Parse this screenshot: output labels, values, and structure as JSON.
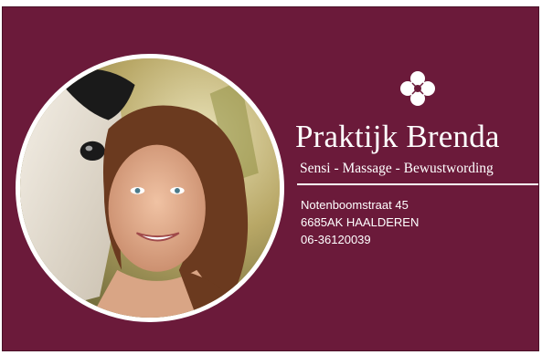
{
  "brand": {
    "name": "Praktijk Brenda",
    "tagline": "Sensi - Massage - Bewustwording",
    "logo_icon": "four-petal-flower-icon"
  },
  "contact": {
    "street": "Notenboomstraat 45",
    "city": "6685AK HAALDEREN",
    "phone": "06-36120039"
  },
  "photo": {
    "description_icon": "portrait-woman-with-horse"
  },
  "colors": {
    "background": "#6b1a3a",
    "text": "#ffffff"
  }
}
